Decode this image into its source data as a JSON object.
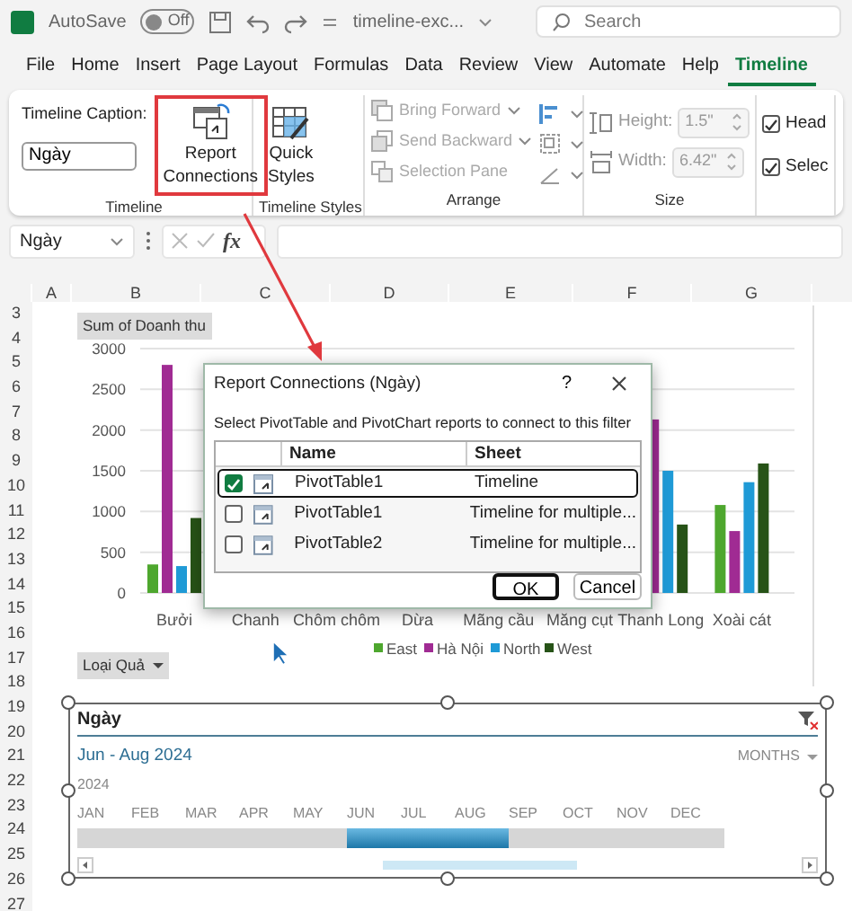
{
  "title_bar": {
    "autosave_label": "AutoSave",
    "autosave_on": false,
    "autosave_state": "Off",
    "file_name": "timeline-exc...",
    "search_placeholder": "Search"
  },
  "ribbon_tabs": [
    {
      "label": "File",
      "selected": false
    },
    {
      "label": "Home",
      "selected": false
    },
    {
      "label": "Insert",
      "selected": false
    },
    {
      "label": "Page Layout",
      "selected": false
    },
    {
      "label": "Formulas",
      "selected": false
    },
    {
      "label": "Data",
      "selected": false
    },
    {
      "label": "Review",
      "selected": false
    },
    {
      "label": "View",
      "selected": false
    },
    {
      "label": "Automate",
      "selected": false
    },
    {
      "label": "Help",
      "selected": false
    },
    {
      "label": "Timeline",
      "selected": true
    }
  ],
  "ribbon": {
    "timeline_group": {
      "caption_label": "Timeline Caption:",
      "caption_value": "Ngày",
      "report_connections": [
        "Report",
        "Connections"
      ],
      "highlighted": true,
      "group_label": "Timeline"
    },
    "styles_group": {
      "button_lines": [
        "Quick",
        "Styles"
      ],
      "group_label": "Timeline Styles"
    },
    "arrange_group": {
      "items": [
        {
          "label": "Bring Forward",
          "disabled": true
        },
        {
          "label": "Send Backward",
          "disabled": true
        },
        {
          "label": "Selection Pane",
          "disabled": true
        }
      ],
      "group_label": "Arrange"
    },
    "size_group": {
      "fields": [
        {
          "label": "Height:",
          "value": "1.5\""
        },
        {
          "label": "Width:",
          "value": "6.42\""
        }
      ],
      "group_label": "Size"
    },
    "show_group": {
      "items": [
        {
          "label": "Head",
          "checked": true
        },
        {
          "label": "Selec",
          "checked": true
        }
      ]
    }
  },
  "formula_bar": {
    "name_box": "Ngày",
    "function_label": "fx"
  },
  "sheet": {
    "columns": [
      "A",
      "B",
      "C",
      "D",
      "E",
      "F",
      "G"
    ],
    "rows": [
      "3",
      "4",
      "5",
      "6",
      "7",
      "8",
      "9",
      "10",
      "11",
      "12",
      "13",
      "14",
      "15",
      "16",
      "17",
      "18",
      "19",
      "20",
      "21",
      "22",
      "23",
      "24",
      "25",
      "26",
      "27"
    ]
  },
  "chart": {
    "value_field_button": "Sum of Doanh thu",
    "axis_field_button": "Loại Quả",
    "chart_data": {
      "type": "bar",
      "grid": true,
      "legend": "bottom",
      "categories": [
        "Bưởi",
        "Chanh",
        "Chôm chôm",
        "Dừa",
        "Mãng cầu",
        "Măng cụt",
        "Thanh Long",
        "Xoài cát"
      ],
      "ylim": [
        0,
        3000
      ],
      "yticks": [
        0,
        500,
        1000,
        1500,
        2000,
        2500,
        3000
      ],
      "series": [
        {
          "name": "East",
          "color": "#4ea72e",
          "values": [
            350,
            null,
            null,
            null,
            null,
            null,
            null,
            1080
          ]
        },
        {
          "name": "Hà Nội",
          "color": "#a02b93",
          "values": [
            2800,
            null,
            null,
            null,
            null,
            null,
            2130,
            760
          ]
        },
        {
          "name": "North",
          "color": "#1f9ad6",
          "values": [
            330,
            null,
            null,
            null,
            null,
            null,
            1500,
            1360
          ]
        },
        {
          "name": "West",
          "color": "#275317",
          "values": [
            920,
            null,
            null,
            null,
            null,
            null,
            840,
            1590
          ]
        }
      ]
    }
  },
  "dialog": {
    "title": "Report Connections (Ngày)",
    "help": "?",
    "instruction": "Select PivotTable and PivotChart reports to connect to this filter",
    "columns": [
      "Name",
      "Sheet"
    ],
    "rows": [
      {
        "name": "PivotTable1",
        "sheet": "Timeline",
        "checked": true,
        "selected": true
      },
      {
        "name": "PivotTable1",
        "sheet": "Timeline for multiple...",
        "checked": false,
        "selected": false
      },
      {
        "name": "PivotTable2",
        "sheet": "Timeline for multiple...",
        "checked": false,
        "selected": false
      }
    ],
    "buttons": [
      {
        "label": "OK",
        "default": true
      },
      {
        "label": "Cancel",
        "default": false
      }
    ]
  },
  "timeline": {
    "caption": "Ngày",
    "range": "Jun - Aug 2024",
    "level": "MONTHS",
    "year": "2024",
    "months": [
      {
        "label": "JAN",
        "selected": false
      },
      {
        "label": "FEB",
        "selected": false
      },
      {
        "label": "MAR",
        "selected": false
      },
      {
        "label": "APR",
        "selected": false
      },
      {
        "label": "MAY",
        "selected": false
      },
      {
        "label": "JUN",
        "selected": true
      },
      {
        "label": "JUL",
        "selected": true
      },
      {
        "label": "AUG",
        "selected": true
      },
      {
        "label": "SEP",
        "selected": false
      },
      {
        "label": "OCT",
        "selected": false
      },
      {
        "label": "NOV",
        "selected": false
      },
      {
        "label": "DEC",
        "selected": false
      }
    ]
  }
}
